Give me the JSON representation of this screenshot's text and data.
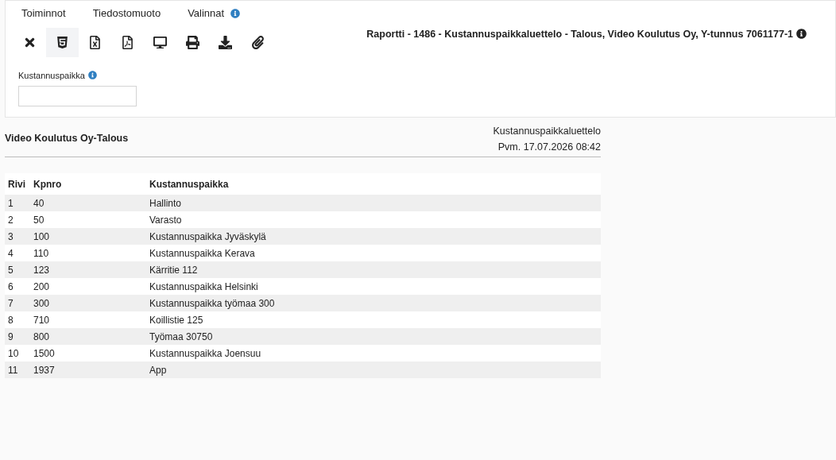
{
  "menu": [
    {
      "label": "Toiminnot",
      "info": false
    },
    {
      "label": "Tiedostomuoto",
      "info": false
    },
    {
      "label": "Valinnat",
      "info": true
    }
  ],
  "toolbar": [
    {
      "kind": "close",
      "selected": false
    },
    {
      "kind": "html",
      "selected": true
    },
    {
      "kind": "excel",
      "selected": false
    },
    {
      "kind": "pdf",
      "selected": false
    },
    {
      "kind": "screen",
      "selected": false
    },
    {
      "kind": "print",
      "selected": false
    },
    {
      "kind": "download",
      "selected": false
    },
    {
      "kind": "attach",
      "selected": false
    }
  ],
  "report_title": "Raportti - 1486 - Kustannuspaikkaluettelo - Talous, Video Koulutus Oy, Y-tunnus 7061177-1",
  "filter": {
    "label": "Kustannuspaikka"
  },
  "report": {
    "company": "Video Koulutus Oy-Talous",
    "name": "Kustannuspaikkaluettelo",
    "date": "Pvm. 17.07.2026 08:42"
  },
  "table": {
    "columns": [
      "Rivi",
      "Kpnro",
      "Kustannuspaikka"
    ],
    "rows": [
      [
        "1",
        "40",
        "Hallinto"
      ],
      [
        "2",
        "50",
        "Varasto"
      ],
      [
        "3",
        "100",
        "Kustannuspaikka Jyväskylä"
      ],
      [
        "4",
        "110",
        "Kustannuspaikka Kerava"
      ],
      [
        "5",
        "123",
        "Kärritie 112"
      ],
      [
        "6",
        "200",
        "Kustannuspaikka Helsinki"
      ],
      [
        "7",
        "300",
        "Kustannuspaikka työmaa 300"
      ],
      [
        "8",
        "710",
        "Koillistie 125"
      ],
      [
        "9",
        "800",
        "Työmaa 30750"
      ],
      [
        "10",
        "1500",
        "Kustannuspaikka Joensuu"
      ],
      [
        "11",
        "1937",
        "App"
      ]
    ]
  }
}
